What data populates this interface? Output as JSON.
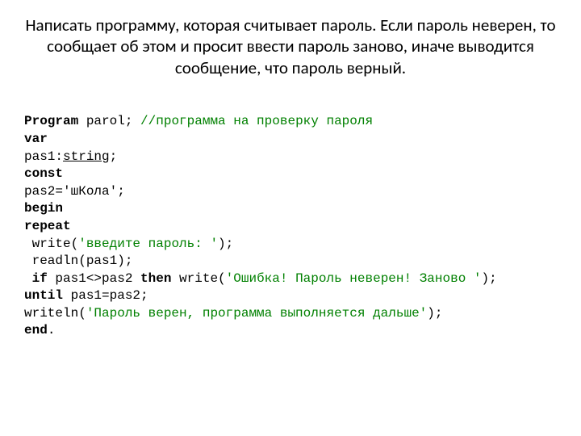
{
  "title": "Написать программу, которая считывает пароль. Если пароль неверен, то сообщает об этом и просит ввести пароль заново, иначе выводится сообщение, что пароль верный.",
  "code": {
    "l1_kw": "Program",
    "l1_rest": " parol; ",
    "l1_cmt": "//программа на проверку пароля",
    "l2_kw": "var",
    "l3_a": "pas1:",
    "l3_type": "string",
    "l3_b": ";",
    "l4_kw": "const",
    "l5": "pas2='шКола';",
    "l6_kw": "begin",
    "l7_kw": "repeat",
    "l8_a": " write(",
    "l8_str": "'введите пароль: '",
    "l8_b": ");",
    "l9": " readln(pas1);",
    "l10_a": " ",
    "l10_kw1": "if",
    "l10_b": " pas1<>pas2 ",
    "l10_kw2": "then",
    "l10_c": " write(",
    "l10_str": "'Ошибка! Пароль неверен! Заново '",
    "l10_d": ");",
    "l11_kw": "until",
    "l11_rest": " pas1=pas2;",
    "l12_a": "writeln(",
    "l12_str": "'Пароль верен, программа выполняется дальше'",
    "l12_b": ");",
    "l13_kw": "end",
    "l13_rest": "."
  }
}
